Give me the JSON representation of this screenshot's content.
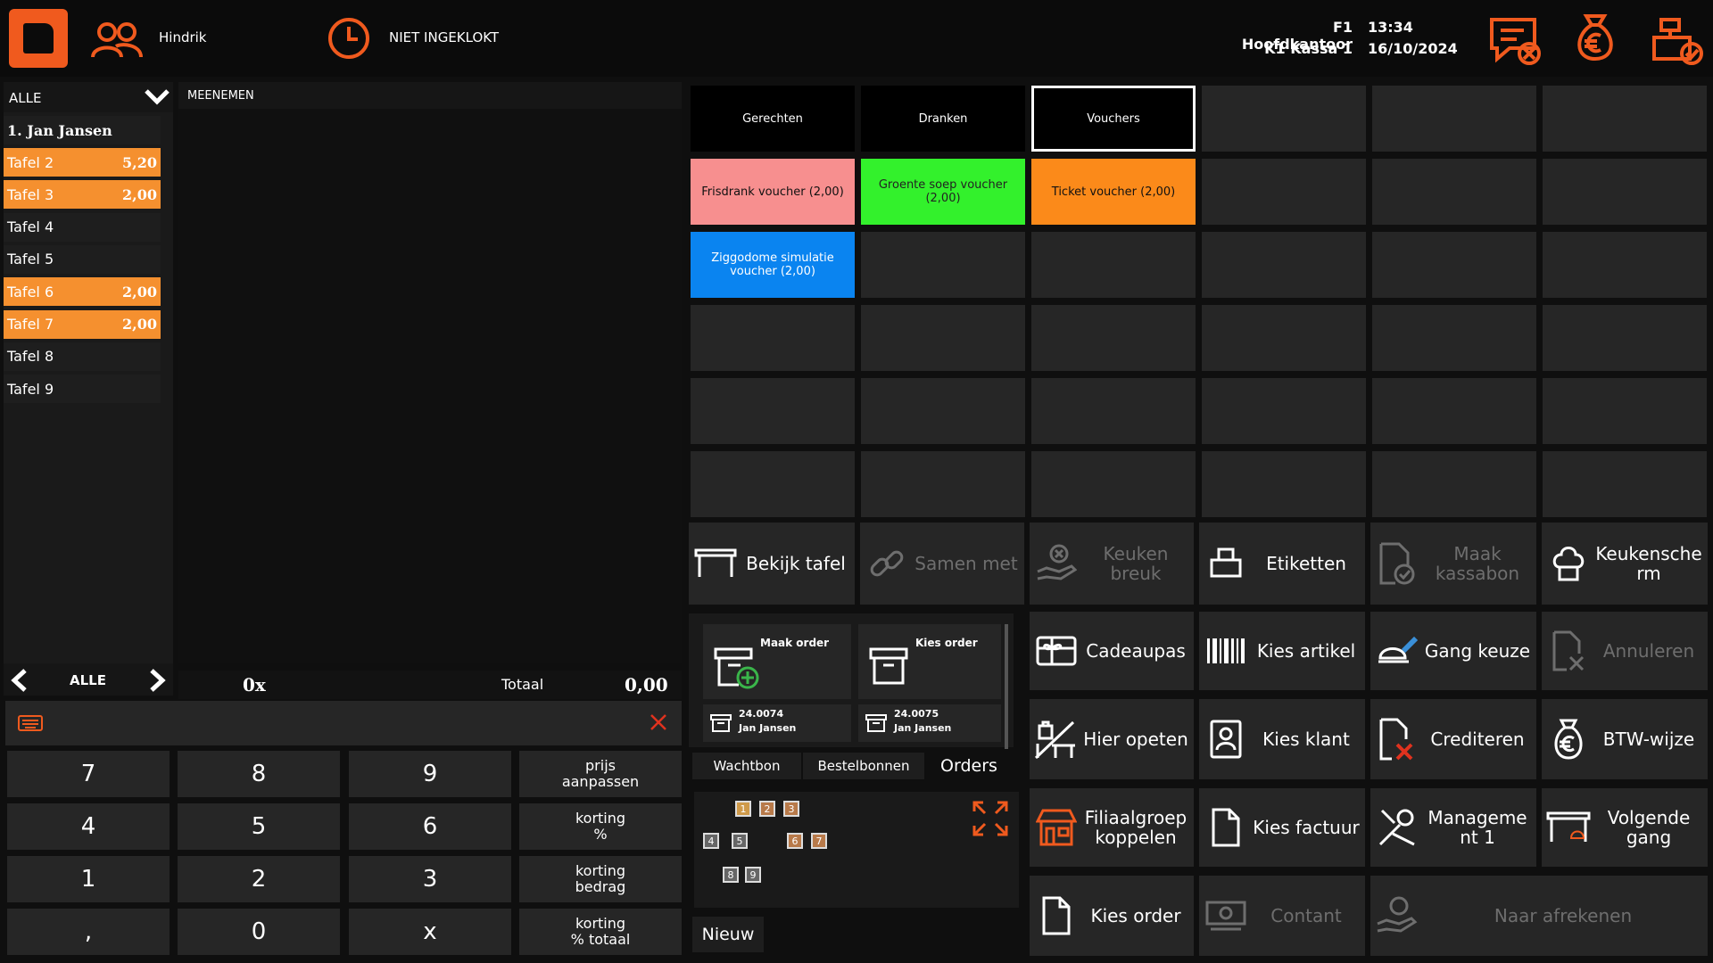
{
  "header": {
    "user": "Hindrik",
    "clock_status": "NIET INGEKLOKT",
    "branch": "F1 Hoofdkantoor",
    "register": "K1 Kassa 1",
    "time": "13:34",
    "date": "16/10/2024"
  },
  "list": {
    "filter": "ALLE",
    "customer_header": "1. Jan Jansen",
    "rows": [
      {
        "name": "Tafel 2",
        "amount": "5,20",
        "active": true
      },
      {
        "name": "Tafel 3",
        "amount": "2,00",
        "active": true
      },
      {
        "name": "Tafel 4",
        "amount": "",
        "active": false
      },
      {
        "name": "Tafel 5",
        "amount": "",
        "active": false
      },
      {
        "name": "Tafel 6",
        "amount": "2,00",
        "active": true
      },
      {
        "name": "Tafel 7",
        "amount": "2,00",
        "active": true
      },
      {
        "name": "Tafel 8",
        "amount": "",
        "active": false
      },
      {
        "name": "Tafel 9",
        "amount": "",
        "active": false
      }
    ],
    "pager_label": "ALLE"
  },
  "order": {
    "title": "MEENEMEN",
    "count": "0x",
    "total_label": "Totaal",
    "total_value": "0,00"
  },
  "categories": [
    "Gerechten",
    "Dranken",
    "Vouchers"
  ],
  "products": [
    {
      "label": "Frisdrank voucher (2,00)",
      "color": "#f78f8f"
    },
    {
      "label": "Groente soep voucher (2,00)",
      "color": "#33f12c"
    },
    {
      "label": "Ticket voucher (2,00)",
      "color": "#fb8a1a"
    },
    {
      "label": "Ziggodome simulatie voucher (2,00)",
      "color": "#0a84f0"
    }
  ],
  "numpad": {
    "keys": [
      "7",
      "8",
      "9",
      "4",
      "5",
      "6",
      "1",
      "2",
      "3",
      ",",
      "0",
      "x"
    ],
    "side": [
      "prijs\naanpassen",
      "korting\n%",
      "korting\nbedrag",
      "korting\n% totaal"
    ]
  },
  "orders_panel": {
    "make_order": "Maak order",
    "choose_order": "Kies order",
    "order_a_num": "24.0074",
    "order_a_name": "Jan Jansen",
    "order_b_num": "24.0075",
    "order_b_name": "Jan Jansen",
    "tabs": [
      "Wachtbon",
      "Bestelbonnen",
      "Orders"
    ],
    "tables": [
      "1",
      "2",
      "3",
      "4",
      "5",
      "6",
      "7",
      "8",
      "9"
    ],
    "new_label": "Nieuw"
  },
  "functions": {
    "bekijk_tafel": "Bekijk tafel",
    "samen_met": "Samen met",
    "keuken_breuk": "Keuken breuk",
    "etiketten": "Etiketten",
    "maak_kassabon": "Maak kassabon",
    "keukenscherm": "Keukensche rm",
    "cadeaupas": "Cadeaupas",
    "kies_artikel": "Kies artikel",
    "gang_keuze": "Gang keuze",
    "annuleren": "Annuleren",
    "hier_opeten": "Hier opeten",
    "kies_klant": "Kies klant",
    "crediteren": "Crediteren",
    "btw_wijze": "BTW-wijze",
    "filiaalgroep": "Filiaalgroep koppelen",
    "kies_factuur": "Kies factuur",
    "management": "Manageme nt 1",
    "volgende_gang": "Volgende gang",
    "kies_order": "Kies order",
    "contant": "Contant",
    "naar_afrekenen": "Naar afrekenen"
  },
  "colors": {
    "accent": "#f05a1e",
    "tile": "#262626",
    "background": "#0f0f0f"
  }
}
